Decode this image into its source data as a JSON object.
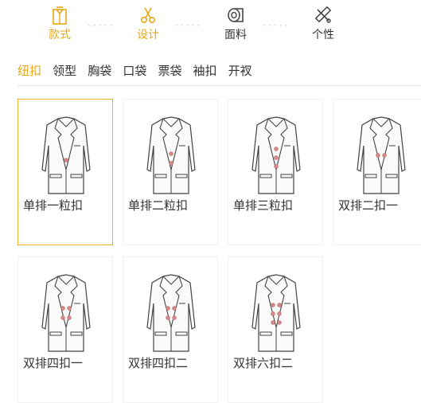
{
  "steps": [
    {
      "label": "款式",
      "icon": "shirt-icon",
      "active": true
    },
    {
      "label": "设计",
      "icon": "scissors-icon",
      "active": true
    },
    {
      "label": "面料",
      "icon": "fabric-roll-icon",
      "active": false
    },
    {
      "label": "个性",
      "icon": "tools-icon",
      "active": false
    }
  ],
  "categories": [
    "纽扣",
    "领型",
    "胸袋",
    "口袋",
    "票袋",
    "袖扣",
    "开衩"
  ],
  "selected_category": "纽扣",
  "items": [
    {
      "name": "单排一粒扣",
      "selected": true
    },
    {
      "name": "单排二粒扣",
      "selected": false
    },
    {
      "name": "单排三粒扣",
      "selected": false
    },
    {
      "name": "双排二扣一",
      "selected": false
    },
    {
      "name": "双排四扣一",
      "selected": false
    },
    {
      "name": "双排四扣二",
      "selected": false
    },
    {
      "name": "双排六扣二",
      "selected": false
    }
  ],
  "colors": {
    "accent": "#e6a817",
    "button_dot": "#d9888a"
  }
}
